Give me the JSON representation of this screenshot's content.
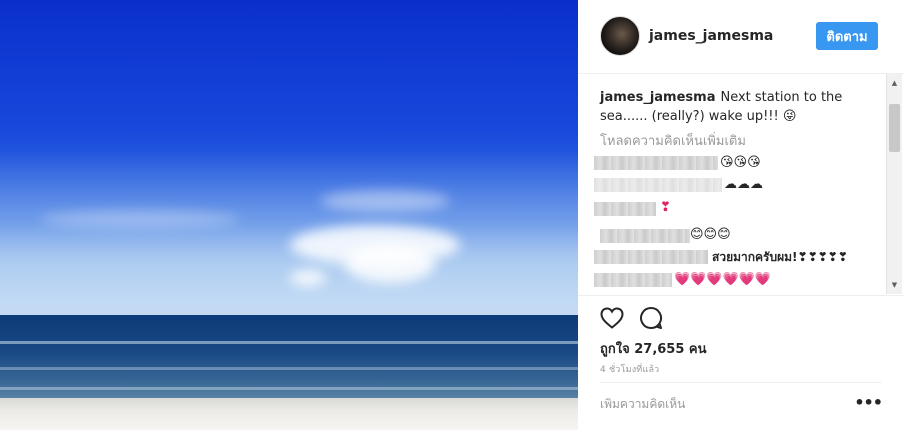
{
  "post": {
    "username": "james_jamesma",
    "follow_label": "ติดตาม",
    "caption_user": "james_jamesma",
    "caption_text": "Next station to the sea...... (really?) wake up!!! 😜",
    "load_more": "โหลดความคิดเห็นเพิ่มเติม",
    "comments": [
      {
        "text": "😘😘😘"
      },
      {
        "text": "☁☁☁"
      },
      {
        "text": "❣"
      },
      {
        "text": "😊😊😊"
      },
      {
        "text": "สวยมากครับผม!❣❣❣❣❣"
      },
      {
        "text": "💗💗💗💗💗💗"
      }
    ],
    "likes": "ถูกใจ 27,655 คน",
    "time": "4 ชั่วโมงที่แล้ว",
    "comment_placeholder": "เพิ่มความคิดเห็น",
    "more_label": "•••",
    "scroll_up": "▲",
    "scroll_down": "▼"
  },
  "icons": {
    "like": "heart-icon",
    "comment": "comment-bubble-icon"
  },
  "colors": {
    "follow_button": "#3897f0",
    "muted_text": "#999999",
    "text": "#262626"
  }
}
